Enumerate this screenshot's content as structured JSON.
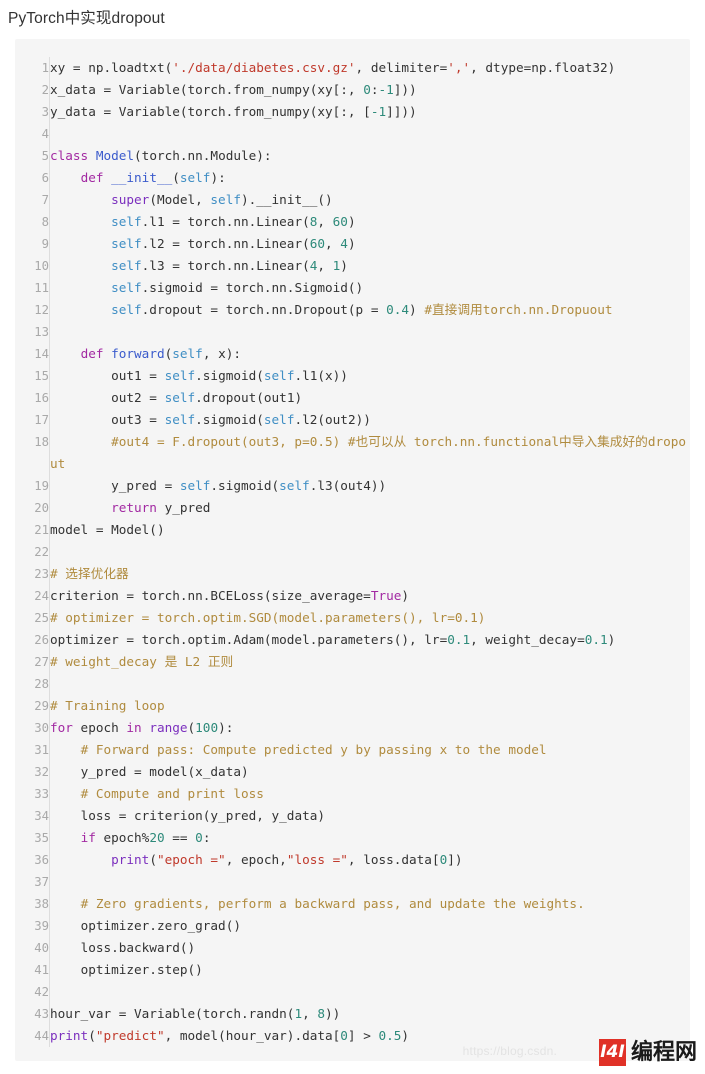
{
  "page": {
    "title": "PyTorch中实现dropout"
  },
  "watermark": {
    "url_text": "https://blog.csdn.",
    "brand_mark": "I4I",
    "brand_name": "编程网"
  },
  "code_block": {
    "language": "python",
    "line_count": 44,
    "lines": [
      {
        "n": "1",
        "tokens": [
          {
            "t": "pln",
            "v": "xy = np.loadtxt("
          },
          {
            "t": "str",
            "v": "'./data/diabetes.csv.gz'"
          },
          {
            "t": "pln",
            "v": ", delimiter="
          },
          {
            "t": "str",
            "v": "','"
          },
          {
            "t": "pln",
            "v": ", dtype=np.float32)"
          }
        ]
      },
      {
        "n": "2",
        "tokens": [
          {
            "t": "pln",
            "v": "x_data = Variable(torch.from_numpy(xy[:, "
          },
          {
            "t": "num",
            "v": "0"
          },
          {
            "t": "pln",
            "v": ":"
          },
          {
            "t": "num",
            "v": "-1"
          },
          {
            "t": "pln",
            "v": "]))"
          }
        ]
      },
      {
        "n": "3",
        "tokens": [
          {
            "t": "pln",
            "v": "y_data = Variable(torch.from_numpy(xy[:, ["
          },
          {
            "t": "num",
            "v": "-1"
          },
          {
            "t": "pln",
            "v": "]]))"
          }
        ]
      },
      {
        "n": "4",
        "tokens": [
          {
            "t": "pln",
            "v": ""
          }
        ]
      },
      {
        "n": "5",
        "tokens": [
          {
            "t": "kw",
            "v": "class "
          },
          {
            "t": "cls",
            "v": "Model"
          },
          {
            "t": "pln",
            "v": "(torch.nn.Module):"
          }
        ]
      },
      {
        "n": "6",
        "tokens": [
          {
            "t": "pln",
            "v": "    "
          },
          {
            "t": "kw",
            "v": "def "
          },
          {
            "t": "cls",
            "v": "__init__"
          },
          {
            "t": "pln",
            "v": "("
          },
          {
            "t": "slf",
            "v": "self"
          },
          {
            "t": "pln",
            "v": "):"
          }
        ]
      },
      {
        "n": "7",
        "tokens": [
          {
            "t": "pln",
            "v": "        "
          },
          {
            "t": "bi",
            "v": "super"
          },
          {
            "t": "pln",
            "v": "(Model, "
          },
          {
            "t": "slf",
            "v": "self"
          },
          {
            "t": "pln",
            "v": ").__init__()"
          }
        ]
      },
      {
        "n": "8",
        "tokens": [
          {
            "t": "pln",
            "v": "        "
          },
          {
            "t": "slf",
            "v": "self"
          },
          {
            "t": "pln",
            "v": ".l1 = torch.nn.Linear("
          },
          {
            "t": "num",
            "v": "8"
          },
          {
            "t": "pln",
            "v": ", "
          },
          {
            "t": "num",
            "v": "60"
          },
          {
            "t": "pln",
            "v": ")"
          }
        ]
      },
      {
        "n": "9",
        "tokens": [
          {
            "t": "pln",
            "v": "        "
          },
          {
            "t": "slf",
            "v": "self"
          },
          {
            "t": "pln",
            "v": ".l2 = torch.nn.Linear("
          },
          {
            "t": "num",
            "v": "60"
          },
          {
            "t": "pln",
            "v": ", "
          },
          {
            "t": "num",
            "v": "4"
          },
          {
            "t": "pln",
            "v": ")"
          }
        ]
      },
      {
        "n": "10",
        "tokens": [
          {
            "t": "pln",
            "v": "        "
          },
          {
            "t": "slf",
            "v": "self"
          },
          {
            "t": "pln",
            "v": ".l3 = torch.nn.Linear("
          },
          {
            "t": "num",
            "v": "4"
          },
          {
            "t": "pln",
            "v": ", "
          },
          {
            "t": "num",
            "v": "1"
          },
          {
            "t": "pln",
            "v": ")"
          }
        ]
      },
      {
        "n": "11",
        "tokens": [
          {
            "t": "pln",
            "v": "        "
          },
          {
            "t": "slf",
            "v": "self"
          },
          {
            "t": "pln",
            "v": ".sigmoid = torch.nn.Sigmoid()"
          }
        ]
      },
      {
        "n": "12",
        "tokens": [
          {
            "t": "pln",
            "v": "        "
          },
          {
            "t": "slf",
            "v": "self"
          },
          {
            "t": "pln",
            "v": ".dropout = torch.nn.Dropout(p = "
          },
          {
            "t": "num",
            "v": "0.4"
          },
          {
            "t": "pln",
            "v": ") "
          },
          {
            "t": "cmt",
            "v": "#直接调用torch.nn.Dropuout"
          }
        ]
      },
      {
        "n": "13",
        "tokens": [
          {
            "t": "pln",
            "v": ""
          }
        ]
      },
      {
        "n": "14",
        "tokens": [
          {
            "t": "pln",
            "v": "    "
          },
          {
            "t": "kw",
            "v": "def "
          },
          {
            "t": "cls",
            "v": "forward"
          },
          {
            "t": "pln",
            "v": "("
          },
          {
            "t": "slf",
            "v": "self"
          },
          {
            "t": "pln",
            "v": ", x):"
          }
        ]
      },
      {
        "n": "15",
        "tokens": [
          {
            "t": "pln",
            "v": "        out1 = "
          },
          {
            "t": "slf",
            "v": "self"
          },
          {
            "t": "pln",
            "v": ".sigmoid("
          },
          {
            "t": "slf",
            "v": "self"
          },
          {
            "t": "pln",
            "v": ".l1(x))"
          }
        ]
      },
      {
        "n": "16",
        "tokens": [
          {
            "t": "pln",
            "v": "        out2 = "
          },
          {
            "t": "slf",
            "v": "self"
          },
          {
            "t": "pln",
            "v": ".dropout(out1)"
          }
        ]
      },
      {
        "n": "17",
        "tokens": [
          {
            "t": "pln",
            "v": "        out3 = "
          },
          {
            "t": "slf",
            "v": "self"
          },
          {
            "t": "pln",
            "v": ".sigmoid("
          },
          {
            "t": "slf",
            "v": "self"
          },
          {
            "t": "pln",
            "v": ".l2(out2))"
          }
        ]
      },
      {
        "n": "18",
        "tokens": [
          {
            "t": "pln",
            "v": "        "
          },
          {
            "t": "cmt",
            "v": "#out4 = F.dropout(out3, p=0.5) #也可以从 torch.nn.functional中导入集成好的dropout"
          }
        ]
      },
      {
        "n": "19",
        "tokens": [
          {
            "t": "pln",
            "v": "        y_pred = "
          },
          {
            "t": "slf",
            "v": "self"
          },
          {
            "t": "pln",
            "v": ".sigmoid("
          },
          {
            "t": "slf",
            "v": "self"
          },
          {
            "t": "pln",
            "v": ".l3(out4))"
          }
        ]
      },
      {
        "n": "20",
        "tokens": [
          {
            "t": "pln",
            "v": "        "
          },
          {
            "t": "kw",
            "v": "return"
          },
          {
            "t": "pln",
            "v": " y_pred"
          }
        ]
      },
      {
        "n": "21",
        "tokens": [
          {
            "t": "pln",
            "v": "model = Model()"
          }
        ]
      },
      {
        "n": "22",
        "tokens": [
          {
            "t": "pln",
            "v": ""
          }
        ]
      },
      {
        "n": "23",
        "tokens": [
          {
            "t": "cmt",
            "v": "# 选择优化器"
          }
        ]
      },
      {
        "n": "24",
        "tokens": [
          {
            "t": "pln",
            "v": "criterion = torch.nn.BCELoss(size_average="
          },
          {
            "t": "kw",
            "v": "True"
          },
          {
            "t": "pln",
            "v": ")"
          }
        ]
      },
      {
        "n": "25",
        "tokens": [
          {
            "t": "cmt",
            "v": "# optimizer = torch.optim.SGD(model.parameters(), lr=0.1)"
          }
        ]
      },
      {
        "n": "26",
        "tokens": [
          {
            "t": "pln",
            "v": "optimizer = torch.optim.Adam(model.parameters(), lr="
          },
          {
            "t": "num",
            "v": "0.1"
          },
          {
            "t": "pln",
            "v": ", weight_decay="
          },
          {
            "t": "num",
            "v": "0.1"
          },
          {
            "t": "pln",
            "v": ")"
          }
        ]
      },
      {
        "n": "27",
        "tokens": [
          {
            "t": "cmt",
            "v": "# weight_decay 是 L2 正则"
          }
        ]
      },
      {
        "n": "28",
        "tokens": [
          {
            "t": "pln",
            "v": ""
          }
        ]
      },
      {
        "n": "29",
        "tokens": [
          {
            "t": "cmt",
            "v": "# Training loop"
          }
        ]
      },
      {
        "n": "30",
        "tokens": [
          {
            "t": "kw",
            "v": "for"
          },
          {
            "t": "pln",
            "v": " epoch "
          },
          {
            "t": "kw",
            "v": "in"
          },
          {
            "t": "pln",
            "v": " "
          },
          {
            "t": "bi",
            "v": "range"
          },
          {
            "t": "pln",
            "v": "("
          },
          {
            "t": "num",
            "v": "100"
          },
          {
            "t": "pln",
            "v": "):"
          }
        ]
      },
      {
        "n": "31",
        "tokens": [
          {
            "t": "pln",
            "v": "    "
          },
          {
            "t": "cmt",
            "v": "# Forward pass: Compute predicted y by passing x to the model"
          }
        ]
      },
      {
        "n": "32",
        "tokens": [
          {
            "t": "pln",
            "v": "    y_pred = model(x_data)"
          }
        ]
      },
      {
        "n": "33",
        "tokens": [
          {
            "t": "pln",
            "v": "    "
          },
          {
            "t": "cmt",
            "v": "# Compute and print loss"
          }
        ]
      },
      {
        "n": "34",
        "tokens": [
          {
            "t": "pln",
            "v": "    loss = criterion(y_pred, y_data)"
          }
        ]
      },
      {
        "n": "35",
        "tokens": [
          {
            "t": "pln",
            "v": "    "
          },
          {
            "t": "kw",
            "v": "if"
          },
          {
            "t": "pln",
            "v": " epoch%"
          },
          {
            "t": "num",
            "v": "20"
          },
          {
            "t": "pln",
            "v": " == "
          },
          {
            "t": "num",
            "v": "0"
          },
          {
            "t": "pln",
            "v": ":"
          }
        ]
      },
      {
        "n": "36",
        "tokens": [
          {
            "t": "pln",
            "v": "        "
          },
          {
            "t": "bi",
            "v": "print"
          },
          {
            "t": "pln",
            "v": "("
          },
          {
            "t": "str",
            "v": "\"epoch =\""
          },
          {
            "t": "pln",
            "v": ", epoch,"
          },
          {
            "t": "str",
            "v": "\"loss =\""
          },
          {
            "t": "pln",
            "v": ", loss.data["
          },
          {
            "t": "num",
            "v": "0"
          },
          {
            "t": "pln",
            "v": "])"
          }
        ]
      },
      {
        "n": "37",
        "tokens": [
          {
            "t": "pln",
            "v": ""
          }
        ]
      },
      {
        "n": "38",
        "tokens": [
          {
            "t": "pln",
            "v": "    "
          },
          {
            "t": "cmt",
            "v": "# Zero gradients, perform a backward pass, and update the weights."
          }
        ]
      },
      {
        "n": "39",
        "tokens": [
          {
            "t": "pln",
            "v": "    optimizer.zero_grad()"
          }
        ]
      },
      {
        "n": "40",
        "tokens": [
          {
            "t": "pln",
            "v": "    loss.backward()"
          }
        ]
      },
      {
        "n": "41",
        "tokens": [
          {
            "t": "pln",
            "v": "    optimizer.step()"
          }
        ]
      },
      {
        "n": "42",
        "tokens": [
          {
            "t": "pln",
            "v": ""
          }
        ]
      },
      {
        "n": "43",
        "tokens": [
          {
            "t": "pln",
            "v": "hour_var = Variable(torch.randn("
          },
          {
            "t": "num",
            "v": "1"
          },
          {
            "t": "pln",
            "v": ", "
          },
          {
            "t": "num",
            "v": "8"
          },
          {
            "t": "pln",
            "v": "))"
          }
        ]
      },
      {
        "n": "44",
        "tokens": [
          {
            "t": "bi",
            "v": "print"
          },
          {
            "t": "pln",
            "v": "("
          },
          {
            "t": "str",
            "v": "\"predict\""
          },
          {
            "t": "pln",
            "v": ", model(hour_var).data["
          },
          {
            "t": "num",
            "v": "0"
          },
          {
            "t": "pln",
            "v": "] > "
          },
          {
            "t": "num",
            "v": "0.5"
          },
          {
            "t": "pln",
            "v": ")"
          }
        ]
      }
    ]
  }
}
